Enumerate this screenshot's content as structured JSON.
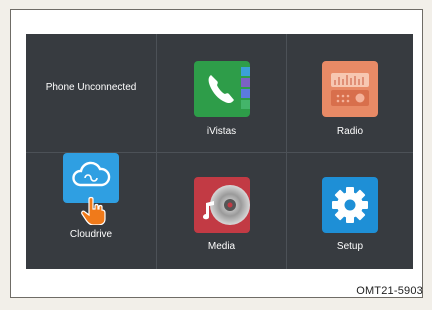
{
  "status": {
    "phone": "Phone Unconnected"
  },
  "apps": [
    {
      "label": "iVistas",
      "icon": "phone-icon"
    },
    {
      "label": "Radio",
      "icon": "radio-icon"
    },
    {
      "label": "Cloudrive",
      "icon": "cloud-icon"
    },
    {
      "label": "Media",
      "icon": "media-disc-icon"
    },
    {
      "label": "Setup",
      "icon": "gear-icon"
    }
  ],
  "figure_caption": "OMT21-5903",
  "colors": {
    "screen_bg": "#373b40",
    "ivistas_green": "#2e9d49",
    "radio_orange": "#e88a66",
    "cloud_blue": "#2f9fe2",
    "media_red": "#c23a44",
    "setup_blue": "#1e8fd6",
    "hand_orange": "#f07a1a"
  }
}
